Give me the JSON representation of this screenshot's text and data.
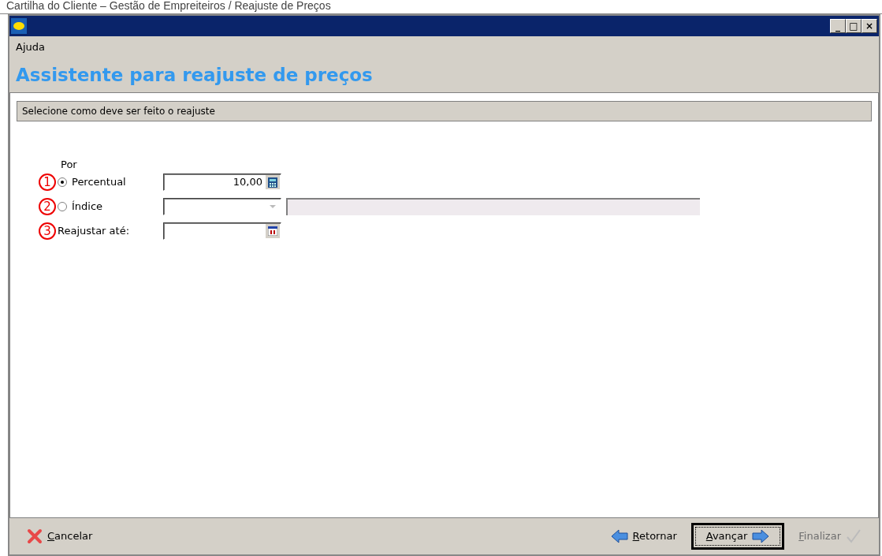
{
  "caption": "Cartilha do Cliente – Gestão de Empreiteiros / Reajuste de Preços",
  "window": {
    "controls": [
      "_",
      "□",
      "×"
    ]
  },
  "menu": [
    "Ajuda"
  ],
  "heading": "Assistente para reajuste de preços",
  "section": "Selecione como deve ser feito o reajuste",
  "group_label": "Por",
  "rows": [
    {
      "marker": "1",
      "kind": "radio",
      "label": "Percentual",
      "selected": true,
      "value": "10,00"
    },
    {
      "marker": "2",
      "kind": "radio",
      "label": "Índice",
      "selected": false
    },
    {
      "marker": "3",
      "kind": "label",
      "label": "Reajustar até:"
    }
  ],
  "buttons": [
    {
      "label": "Cancelar",
      "disabled": false,
      "default": false
    },
    {
      "label": "Retornar",
      "disabled": false,
      "default": false
    },
    {
      "label": "Avançar",
      "disabled": false,
      "default": true
    },
    {
      "label": "Finalizar",
      "disabled": true,
      "default": false
    }
  ]
}
